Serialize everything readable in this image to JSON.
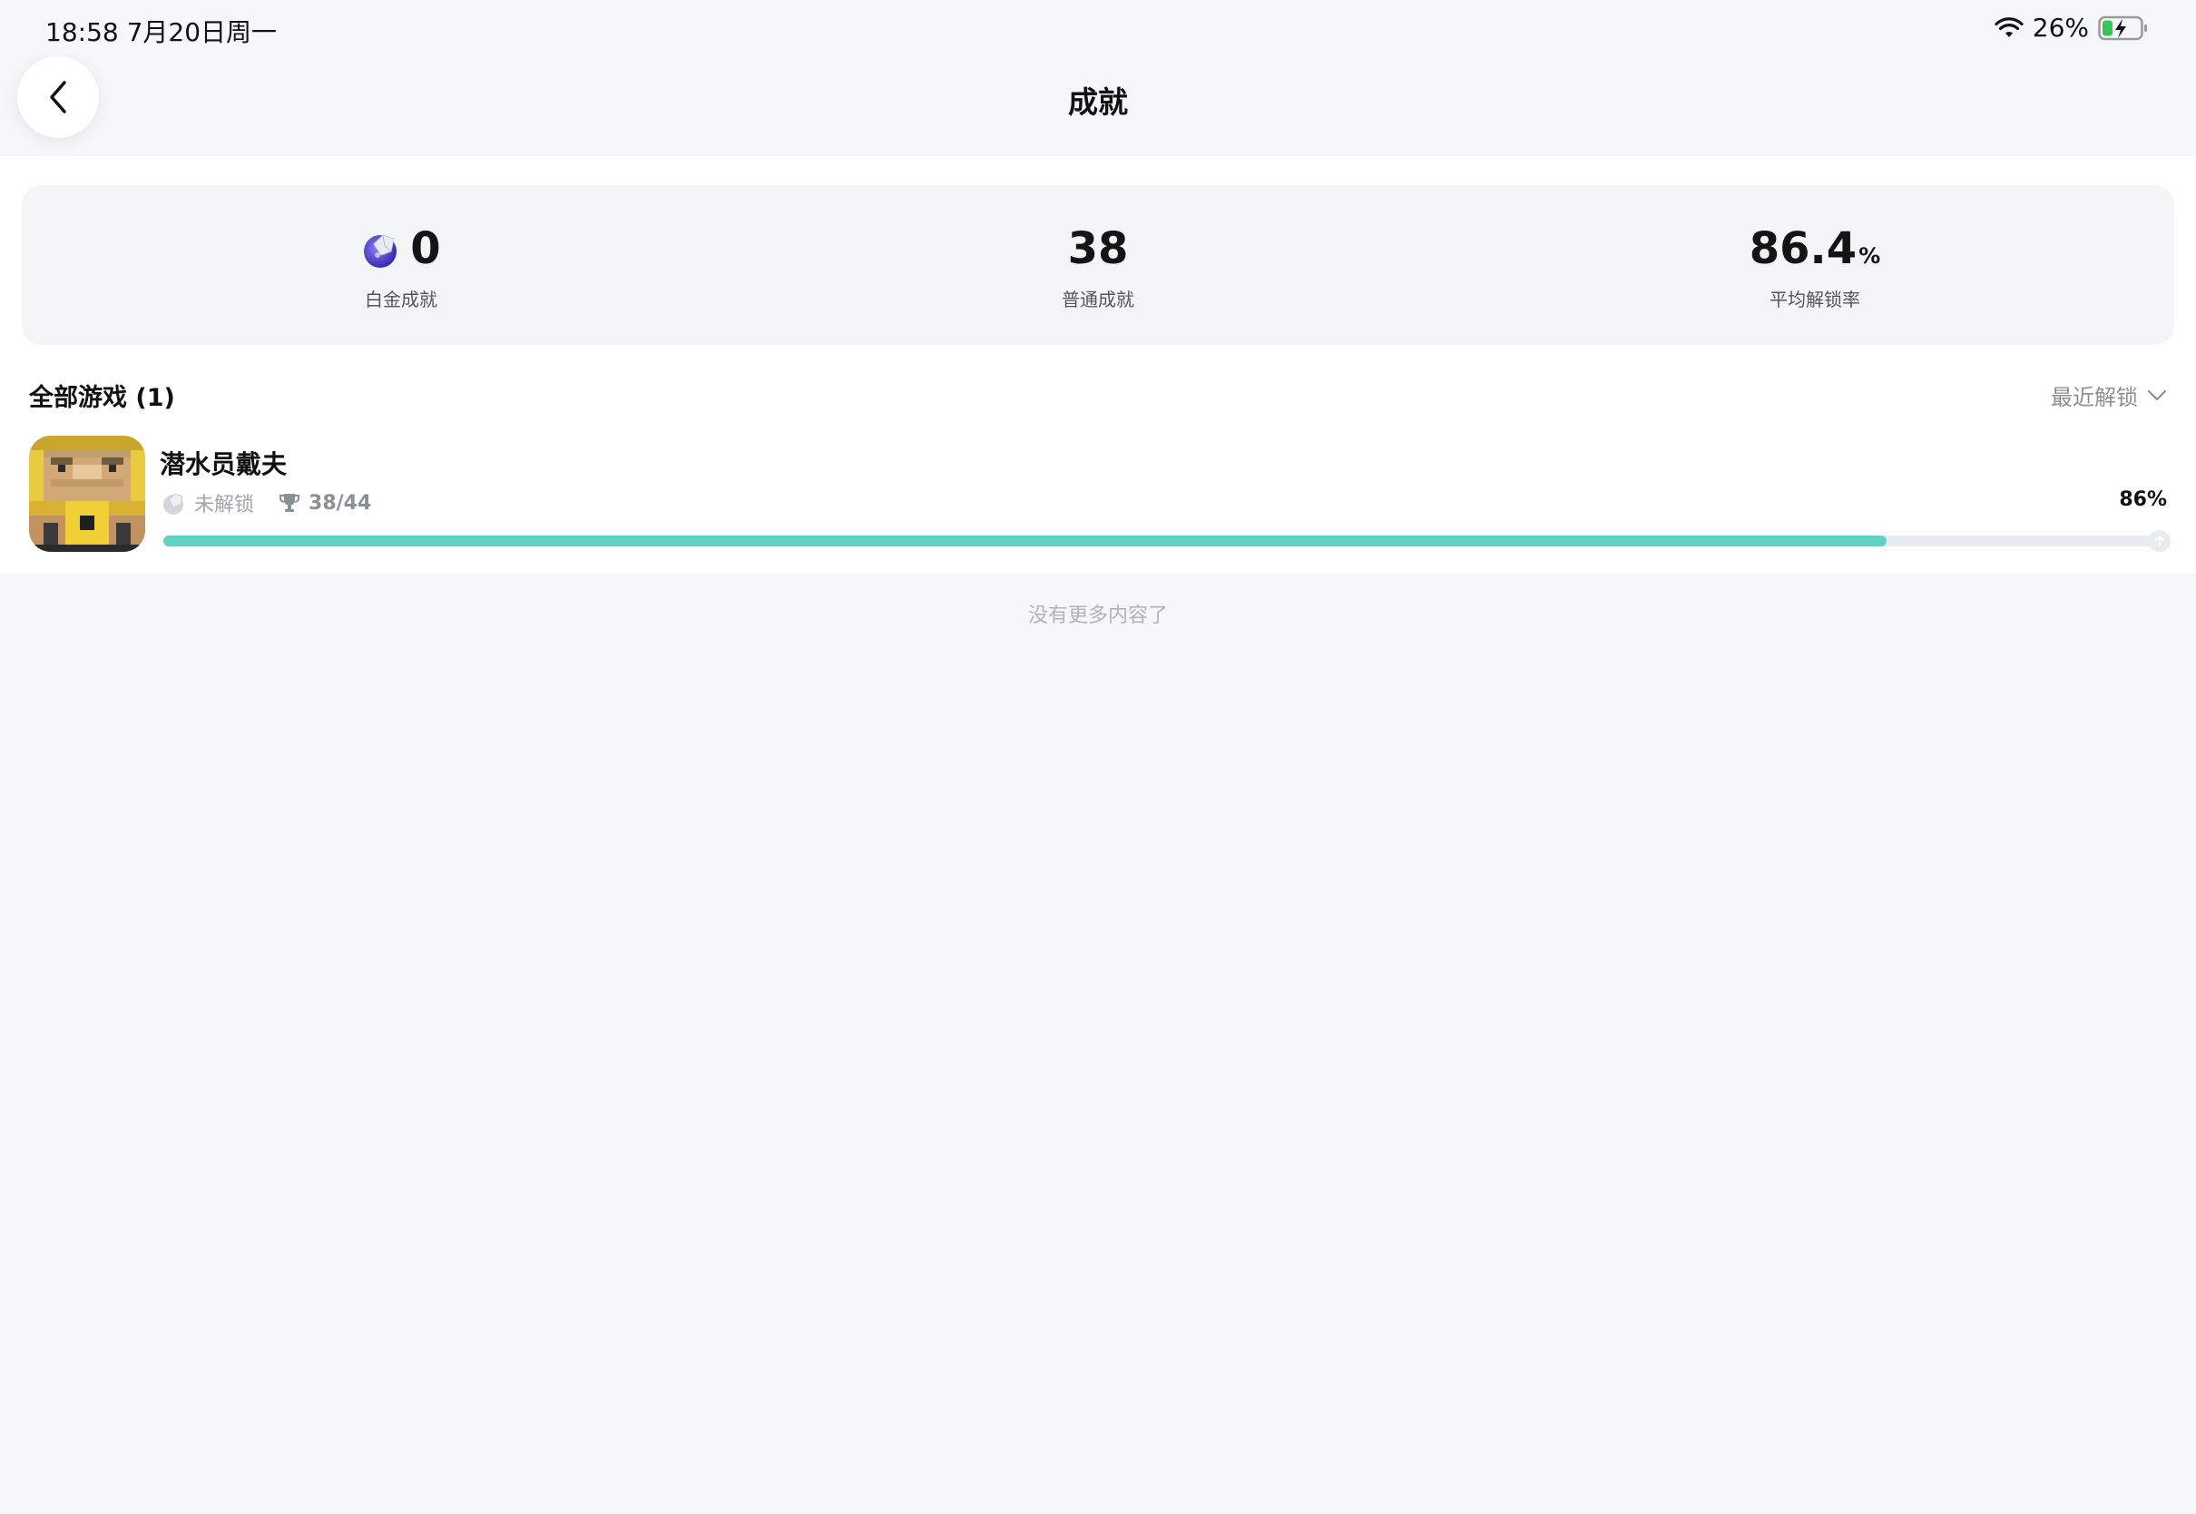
{
  "status_bar": {
    "time": "18:58   7月20日周一",
    "battery_pct": "26%"
  },
  "nav": {
    "title": "成就"
  },
  "stats": [
    {
      "value": "0",
      "unit": "",
      "label": "白金成就"
    },
    {
      "value": "38",
      "unit": "",
      "label": "普通成就"
    },
    {
      "value": "86.4",
      "unit": "%",
      "label": "平均解锁率"
    }
  ],
  "section": {
    "title": "全部游戏 (1)",
    "sort_label": "最近解锁"
  },
  "game": {
    "title": "潜水员戴夫",
    "platinum_status": "未解锁",
    "count": "38/44",
    "percent_label": "86%",
    "progress": 0.86
  },
  "footer": {
    "end_text": "没有更多内容了"
  },
  "colors": {
    "progress_fill": "#5ed3c3",
    "background": "#f6f7f9"
  }
}
